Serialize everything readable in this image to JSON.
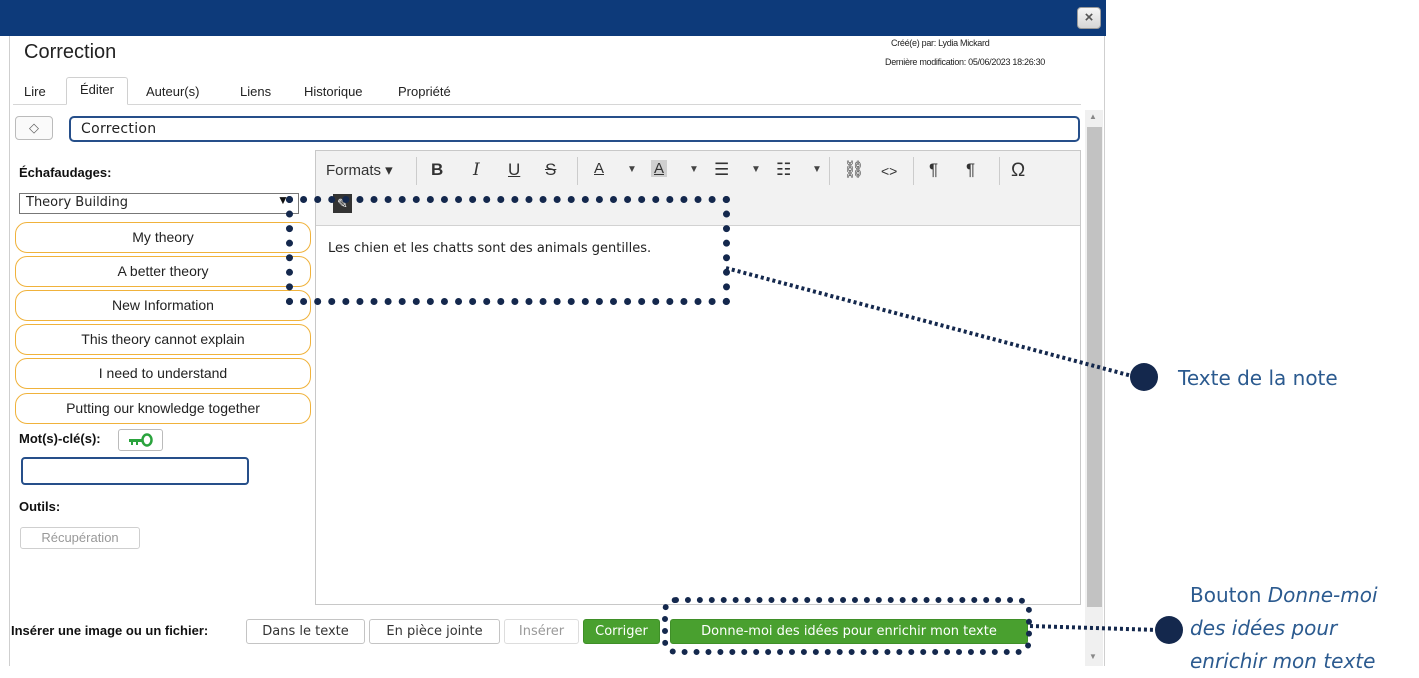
{
  "window": {
    "title": "Correction",
    "close_label": "×"
  },
  "meta": {
    "created": "Créé(e) par: Lydia Mickard",
    "modified": "Dernière modification: 05/06/2023 18:26:30"
  },
  "tabs": [
    "Lire",
    "Éditer",
    "Auteur(s)",
    "Liens",
    "Historique",
    "Propriété"
  ],
  "active_tab": "Éditer",
  "title_toggle_icon": "◇",
  "title_input_value": "Correction",
  "left_panel": {
    "scaffold_label": "Échafaudages:",
    "scaffold_select_value": "Theory Building",
    "scaffolds": [
      "My theory",
      "A better theory",
      "New Information",
      "This theory cannot explain",
      "I need to understand",
      "Putting our knowledge together"
    ],
    "keyword_label": "Mot(s)-clé(s):",
    "keyword_button_icon": "key-icon",
    "keyword_input_value": "",
    "tools_label": "Outils:",
    "recovery_button": "Récupération"
  },
  "editor": {
    "formats_label": "Formats ▾",
    "toolbar_icons": [
      "bold-icon",
      "italic-icon",
      "underline-icon",
      "strikethrough-icon",
      "font-color-icon",
      "highlight-icon",
      "bullet-list-icon",
      "numbered-list-icon",
      "link-icon",
      "code-icon",
      "ltr-icon",
      "rtl-icon",
      "special-char-icon",
      "pencil-icon"
    ],
    "body_text": "Les chien et les chatts sont des animals gentilles."
  },
  "bottom": {
    "insert_label": "Insérer une image ou un fichier:",
    "in_text": "Dans le texte",
    "attachment": "En pièce jointe",
    "insert": "Insérer",
    "correct": "Corriger",
    "ideas": "Donne-moi des idées pour enrichir mon texte"
  },
  "annotations": {
    "note_text_label": "Texte de la note",
    "button_label_prefix": "Bouton ",
    "button_label_emph": "Donne-moi des idées pour enrichir mon texte"
  },
  "colors": {
    "titlebar": "#0d3a7a",
    "accent_green": "#49a02f",
    "scaffold_border": "#f0b23b",
    "annotation_dark": "#14284d",
    "annotation_text": "#2b5a8f"
  }
}
